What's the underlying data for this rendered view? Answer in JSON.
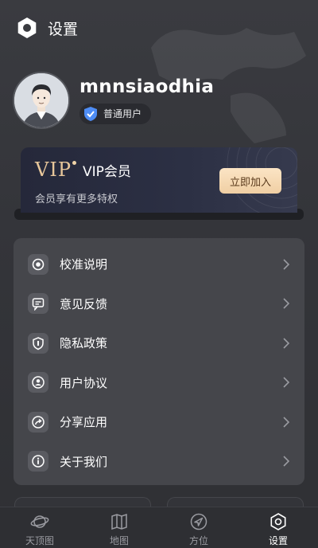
{
  "header": {
    "title": "设置",
    "logo_icon": "hexagon-logo-icon"
  },
  "profile": {
    "username": "mnnsiaodhia",
    "badge_label": "普通用户",
    "badge_icon": "shield-check-icon"
  },
  "vip": {
    "logo": "VIP",
    "title": "VIP会员",
    "subtitle": "会员享有更多特权",
    "join_button": "立即加入",
    "accent": "#e8c79b"
  },
  "menu": {
    "items": [
      {
        "label": "校准说明",
        "icon": "calibration-icon"
      },
      {
        "label": "意见反馈",
        "icon": "feedback-icon"
      },
      {
        "label": "隐私政策",
        "icon": "privacy-shield-icon"
      },
      {
        "label": "用户协议",
        "icon": "user-agreement-icon"
      },
      {
        "label": "分享应用",
        "icon": "share-icon"
      },
      {
        "label": "关于我们",
        "icon": "info-icon"
      }
    ]
  },
  "tabbar": {
    "tabs": [
      {
        "label": "天顶图",
        "icon": "planet-icon",
        "active": false
      },
      {
        "label": "地图",
        "icon": "map-icon",
        "active": false
      },
      {
        "label": "方位",
        "icon": "compass-navigation-icon",
        "active": false
      },
      {
        "label": "设置",
        "icon": "settings-hexagon-icon",
        "active": true
      }
    ]
  }
}
